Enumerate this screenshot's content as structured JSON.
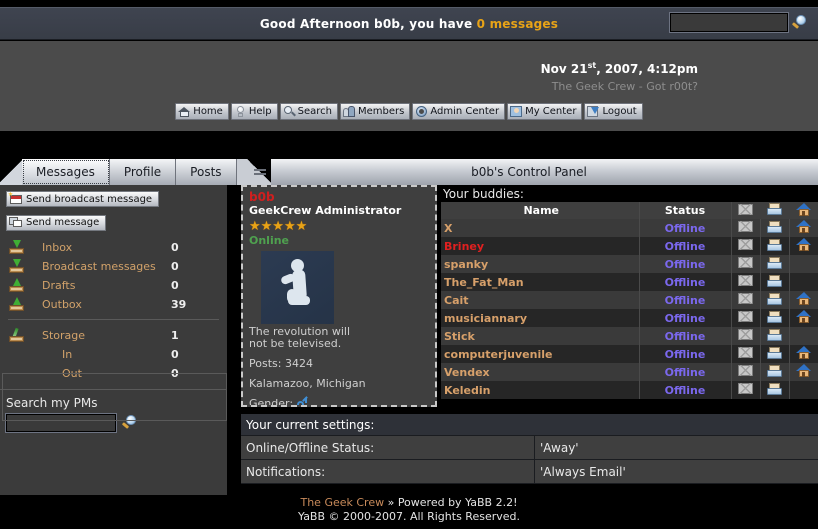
{
  "topbar": {
    "greeting_prefix": "Good Afternoon b0b, you have ",
    "message_count": "0 messages",
    "search_value": "",
    "search_icon": "magnifier-icon"
  },
  "header": {
    "date_month_day": "Nov 21",
    "date_ordinal": "st",
    "date_rest": ", 2007, 4:12pm",
    "tagline": "The Geek Crew - Got r00t?",
    "nav": [
      {
        "label": "Home",
        "icon": "home-icon"
      },
      {
        "label": "Help",
        "icon": "lightbulb-icon"
      },
      {
        "label": "Search",
        "icon": "magnifier-icon"
      },
      {
        "label": "Members",
        "icon": "people-icon"
      },
      {
        "label": "Admin Center",
        "icon": "gear-icon"
      },
      {
        "label": "My Center",
        "icon": "user-card-icon"
      },
      {
        "label": "Logout",
        "icon": "exit-arrow-icon"
      }
    ]
  },
  "tabs": {
    "items": [
      {
        "label": "Messages",
        "active": true
      },
      {
        "label": "Profile",
        "active": false
      },
      {
        "label": "Posts",
        "active": false
      }
    ],
    "panel_title": "b0b's Control Panel"
  },
  "sidebar": {
    "broadcast_button": "Send broadcast message",
    "send_button": "Send message",
    "folders": [
      {
        "label": "Inbox",
        "count": "0",
        "icon": "inbox-down-icon"
      },
      {
        "label": "Broadcast messages",
        "count": "0",
        "icon": "inbox-down-icon"
      },
      {
        "label": "Drafts",
        "count": "0",
        "icon": "outbox-up-icon"
      },
      {
        "label": "Outbox",
        "count": "39",
        "icon": "outbox-up-icon"
      }
    ],
    "storage": [
      {
        "label": "Storage",
        "count": "1",
        "icon": "pen-tray-icon",
        "sub": false
      },
      {
        "label": "In",
        "count": "0",
        "icon": "",
        "sub": true
      },
      {
        "label": "Out",
        "count": "0",
        "icon": "",
        "sub": true
      }
    ],
    "search_title": "Search my PMs",
    "search_value": "",
    "search_icon": "magnifier-icon"
  },
  "profile": {
    "username": "b0b",
    "rank": "GeekCrew Administrator",
    "stars": "★★★★★",
    "online_status": "Online",
    "avatar_icon": "kneeling-figure-avatar",
    "signature_line1": "The revolution will",
    "signature_line2": "not be televised.",
    "posts": "Posts: 3424",
    "location": "Kalamazoo, Michigan",
    "gender_label": "Gender:",
    "gender_icon": "male-symbol-icon"
  },
  "buddies": {
    "title": "Your buddies:",
    "columns": [
      "Name",
      "Status",
      "mail-icon",
      "pm-icon",
      "home-icon"
    ],
    "rows": [
      {
        "name": "X",
        "status": "Offline",
        "red": false,
        "mail": true,
        "pm": true,
        "home": true
      },
      {
        "name": "Briney",
        "status": "Offline",
        "red": true,
        "mail": true,
        "pm": true,
        "home": true
      },
      {
        "name": "spanky",
        "status": "Offline",
        "red": false,
        "mail": true,
        "pm": true,
        "home": false
      },
      {
        "name": "The_Fat_Man",
        "status": "Offline",
        "red": false,
        "mail": true,
        "pm": true,
        "home": false
      },
      {
        "name": "Cait",
        "status": "Offline",
        "red": false,
        "mail": true,
        "pm": true,
        "home": true
      },
      {
        "name": "musiciannary",
        "status": "Offline",
        "red": false,
        "mail": true,
        "pm": true,
        "home": true
      },
      {
        "name": "Stick",
        "status": "Offline",
        "red": false,
        "mail": true,
        "pm": true,
        "home": false
      },
      {
        "name": "computerjuvenile",
        "status": "Offline",
        "red": false,
        "mail": true,
        "pm": true,
        "home": true
      },
      {
        "name": "Vendex",
        "status": "Offline",
        "red": false,
        "mail": true,
        "pm": true,
        "home": true
      },
      {
        "name": "Keledin",
        "status": "Offline",
        "red": false,
        "mail": true,
        "pm": true,
        "home": false
      }
    ]
  },
  "settings": {
    "header": "Your current settings:",
    "rows": [
      {
        "key": "Online/Offline Status:",
        "value": "'Away'"
      },
      {
        "key": "Notifications:",
        "value": "'Always Email'"
      }
    ]
  },
  "footer": {
    "site": "The Geek Crew",
    "powered": " » Powered by YaBB 2.2!",
    "copyright": "YaBB © 2000-2007. All Rights Reserved."
  },
  "colors": {
    "accent_orange": "#e8a317",
    "name_orange": "#d7a06a",
    "name_red": "#e02020",
    "status_purple": "#7b68ee",
    "online_green": "#4fa14f"
  }
}
